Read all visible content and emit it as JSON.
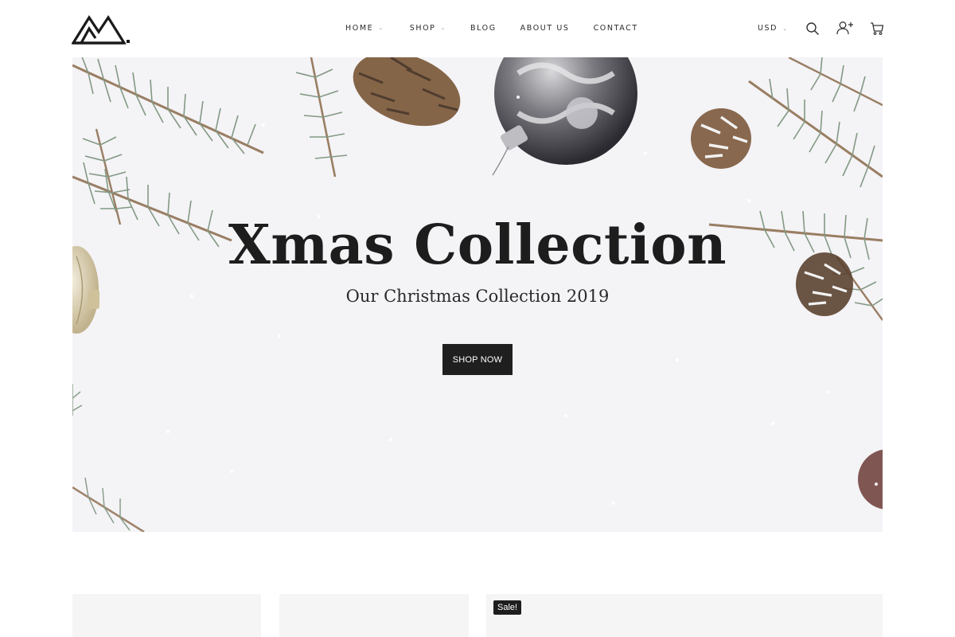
{
  "nav": {
    "items": [
      {
        "label": "HOME",
        "has_dropdown": true
      },
      {
        "label": "SHOP",
        "has_dropdown": true
      },
      {
        "label": "BLOG",
        "has_dropdown": false
      },
      {
        "label": "ABOUT US",
        "has_dropdown": false
      },
      {
        "label": "CONTACT",
        "has_dropdown": false
      }
    ],
    "caret": "⌄"
  },
  "header": {
    "currency": "USD",
    "icons": [
      "search-icon",
      "add-user-icon",
      "cart-icon"
    ]
  },
  "hero": {
    "title": "Xmas Collection",
    "subtitle": "Our Christmas Collection 2019",
    "button_label": "SHOP NOW"
  },
  "products": {
    "badges": [
      "",
      "",
      "Sale!"
    ]
  },
  "colors": {
    "text": "#222222",
    "button_bg": "#1f1f1f",
    "hero_bg": "#f4f3f6",
    "card_bg": "#f5f5f5"
  }
}
